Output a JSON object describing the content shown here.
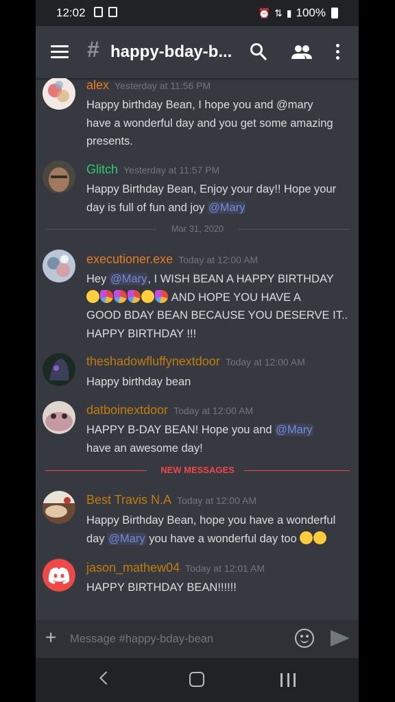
{
  "status_bar": {
    "time": "12:02",
    "battery": "100%"
  },
  "header": {
    "hash": "#",
    "channel": "happy-bday-b..."
  },
  "messages": [
    {
      "user": "alex",
      "color": "#e67e22",
      "timestamp": "Yesterday at 11:56 PM",
      "lines": [
        "Happy birthday Bean, I hope you and @mary",
        "have a wonderful day and you get some amazing",
        "presents."
      ]
    },
    {
      "user": "Glitch",
      "color": "#2ecc71",
      "timestamp": "Yesterday at 11:57 PM",
      "line1": "Happy Birthday Bean, Enjoy your day!! Hope your",
      "line2_pre": "day is full of fun and joy ",
      "mention": "@Mary"
    },
    {
      "user": "executioner.exe",
      "color": "#e67e22",
      "timestamp": "Today at 12:00 AM",
      "line1_pre": "Hey ",
      "mention": "@Mary",
      "line1_post": ", I WISH BEAN A HAPPY BIRTHDAY",
      "line2_post": " AND HOPE YOU HAVE A",
      "line3": "GOOD BDAY BEAN BECAUSE YOU DESERVE IT..",
      "line4": "HAPPY BIRTHDAY !!!"
    },
    {
      "user": "theshadowfluffynextdoor",
      "color": "#c27c0e",
      "timestamp": "Today at 12:00 AM",
      "line1": "Happy birthday bean"
    },
    {
      "user": "datboinextdoor",
      "color": "#c27c0e",
      "timestamp": "Today at 12:00 AM",
      "line1_pre": "HAPPY B-DAY BEAN! Hope you and ",
      "mention": "@Mary",
      "line2": "have an awesome day!"
    },
    {
      "user": "Best Travis N.A",
      "color": "#c27c0e",
      "timestamp": "Today at 12:00 AM",
      "line1": "Happy Birthday Bean, hope you have a wonderful",
      "line2_pre": "day ",
      "mention": "@Mary",
      "line2_post": "  you have a wonderful day too "
    },
    {
      "user": "jason_mathew04",
      "color": "#c27c0e",
      "timestamp": "Today at 12:01 AM",
      "line1": "HAPPY BIRTHDAY BEAN!!!!!!"
    }
  ],
  "dividers": {
    "date": "Mar 31, 2020",
    "new": "NEW MESSAGES"
  },
  "input": {
    "placeholder": "Message #happy-bday-bean"
  },
  "icons": [
    "menu-icon",
    "search-icon",
    "members-icon",
    "more-icon",
    "plus-icon",
    "emoji-icon",
    "send-icon",
    "back-icon",
    "home-icon",
    "recents-icon"
  ]
}
